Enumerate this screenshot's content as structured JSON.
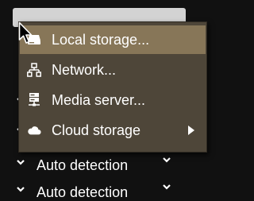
{
  "background": {
    "rows": [
      {
        "label": "Auto detection"
      },
      {
        "label": "Auto detection"
      }
    ]
  },
  "menu": {
    "items": [
      {
        "label": "Local storage...",
        "icon": "drive-icon",
        "selected": true
      },
      {
        "label": "Network...",
        "icon": "network-icon",
        "selected": false
      },
      {
        "label": "Media server...",
        "icon": "server-icon",
        "selected": false
      },
      {
        "label": "Cloud storage",
        "icon": "cloud-icon",
        "selected": false,
        "has_submenu": true
      }
    ]
  },
  "colors": {
    "menu_bg": "#4e4639",
    "selected_bg": "#877658",
    "page_bg": "#111111",
    "text": "#ffffff"
  }
}
